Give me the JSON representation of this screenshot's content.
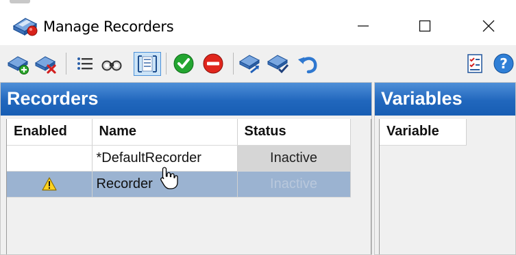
{
  "window": {
    "title": "Manage Recorders"
  },
  "toolbar": {
    "items": [
      "add-recorder-icon",
      "delete-recorder-icon",
      "properties-list-icon",
      "find-binoculars-icon",
      "fit-columns-icon",
      "enable-check-icon",
      "disable-stop-icon",
      "export-recorder-icon",
      "verify-recorder-icon",
      "undo-icon",
      "checklist-icon",
      "help-icon"
    ]
  },
  "recorders": {
    "title": "Recorders",
    "columns": [
      "Enabled",
      "Name",
      "Status"
    ],
    "rows": [
      {
        "enabled": "",
        "name": "*DefaultRecorder",
        "status": "Inactive",
        "warning": false,
        "selected": false
      },
      {
        "enabled": "",
        "name": "Recorder",
        "status": "Inactive",
        "warning": true,
        "selected": true
      }
    ]
  },
  "variables": {
    "title": "Variables",
    "columns": [
      "Variable"
    ]
  },
  "colors": {
    "header_blue": "#2167bd",
    "selected_row": "#9bb3d1",
    "status_cell": "#d6d6d6"
  }
}
